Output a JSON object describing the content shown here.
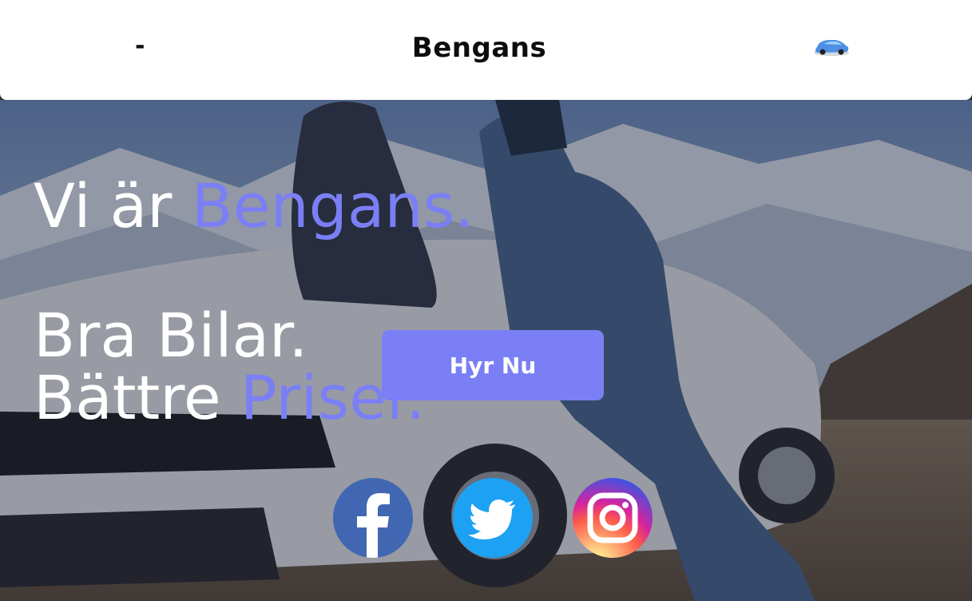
{
  "header": {
    "menu_label": "-",
    "brand": "Bengans",
    "car_icon": "car-icon"
  },
  "hero": {
    "line1_prefix": "Vi är ",
    "line1_accent": "Bengans.",
    "line2": "Bra Bilar.",
    "line3_prefix": "Bättre ",
    "line3_accent": "Priser.",
    "cta_label": "Hyr Nu"
  },
  "social": [
    {
      "icon": "facebook-icon"
    },
    {
      "icon": "twitter-icon"
    },
    {
      "icon": "instagram-icon"
    }
  ],
  "colors": {
    "accent": "#7b7ff5",
    "header_bg": "#ffffff",
    "facebook": "#4267b2",
    "twitter": "#1da1f2"
  }
}
